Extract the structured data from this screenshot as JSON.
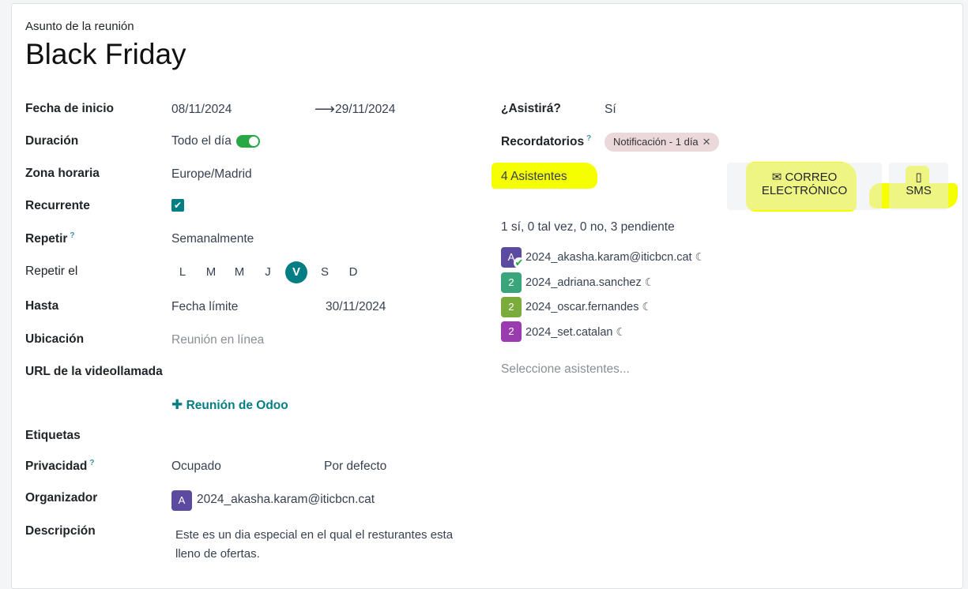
{
  "form": {
    "subject_label": "Asunto de la reunión",
    "title": "Black Friday",
    "start_label": "Fecha de inicio",
    "start_date": "08/11/2024",
    "arrow": "⟶",
    "end_date": "29/11/2024",
    "duration_label": "Duración",
    "all_day_text": "Todo el día",
    "all_day_on": true,
    "timezone_label": "Zona horaria",
    "timezone_value": "Europe/Madrid",
    "recurrent_label": "Recurrente",
    "recurrent_checked": true,
    "repeat_label": "Repetir",
    "repeat_value": "Semanalmente",
    "repeat_on_label": "Repetir el",
    "days": [
      "L",
      "M",
      "M",
      "J",
      "V",
      "S",
      "D"
    ],
    "active_day": "V",
    "until_label": "Hasta",
    "until_type": "Fecha límite",
    "until_date": "30/11/2024",
    "location_label": "Ubicación",
    "location_placeholder": "Reunión en línea",
    "video_url_label": "URL de la videollamada",
    "odoo_meeting_link": "Reunión de Odoo",
    "tags_label": "Etiquetas",
    "privacy_label": "Privacidad",
    "privacy_show_as": "Ocupado",
    "privacy_value": "Por defecto",
    "organizer_label": "Organizador",
    "organizer_initial": "A",
    "organizer_name": "2024_akasha.karam@iticbcn.cat",
    "description_label": "Descripción",
    "description_line1": "Este es un dia especial en el qual el resturantes esta",
    "description_line2": "lleno de ofertas.",
    "tooltip_mark": "?"
  },
  "right": {
    "attend_label": "¿Asistirá?",
    "attend_value": "Sí",
    "reminders_label": "Recordatorios",
    "reminder_tag": "Notificación - 1 día",
    "attendees_count": "4 Asistentes",
    "email_button_line1": "CORREO",
    "email_button_line2": "ELECTRÓNICO",
    "sms_button": "SMS",
    "summary": "1 sí, 0 tal vez, 0 no, 3 pendiente",
    "attendees": [
      {
        "initial": "A",
        "name": "2024_akasha.karam@iticbcn.cat",
        "color": "#5c4aa0",
        "accepted": true
      },
      {
        "initial": "2",
        "name": "2024_adriana.sanchez",
        "color": "#3aa57a",
        "accepted": false
      },
      {
        "initial": "2",
        "name": "2024_oscar.fernandes",
        "color": "#7bab3b",
        "accepted": false
      },
      {
        "initial": "2",
        "name": "2024_set.catalan",
        "color": "#9b3bb0",
        "accepted": false
      }
    ],
    "select_placeholder": "Seleccione asistentes..."
  },
  "colors": {
    "accent": "#017e84",
    "toggle_on": "#28a745",
    "highlight": "#f5ff00"
  }
}
